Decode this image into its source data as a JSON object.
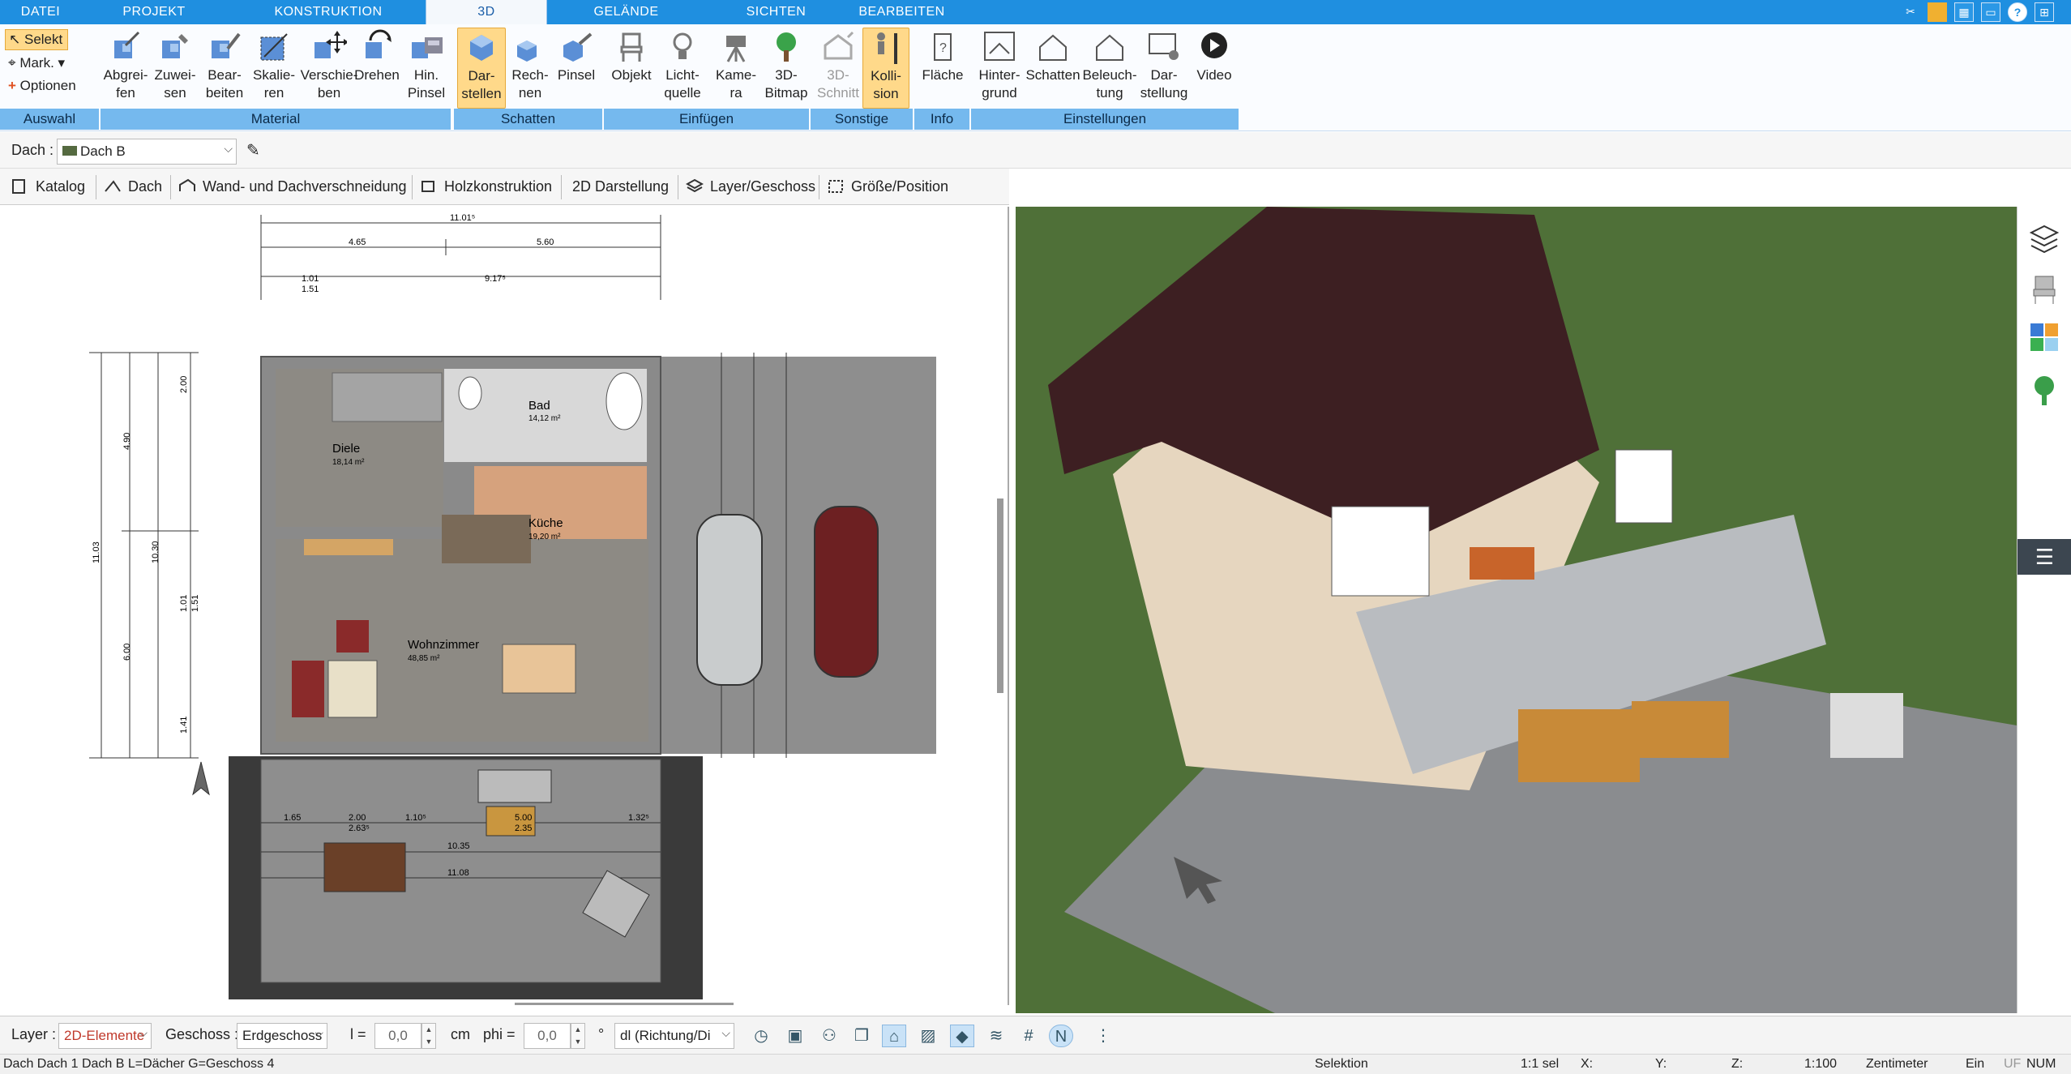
{
  "tabs": [
    "DATEI",
    "PROJEKT",
    "KONSTRUKTION",
    "3D",
    "GELÄNDE",
    "SICHTEN",
    "BEARBEITEN"
  ],
  "auswahl": {
    "select": "Selekt",
    "mark": "Mark.",
    "options": "Optionen",
    "group": "Auswahl"
  },
  "ribbon": {
    "material": [
      "Abgrei-\nfen",
      "Zuwei-\nsen",
      "Bear-\nbeiten",
      "Skalie-\nren",
      "Verschie-\nben",
      "Drehen",
      "Hin.\nPinsel"
    ],
    "schatten": [
      "Dar-\nstellen",
      "Rech-\nnen",
      "Pinsel"
    ],
    "einfuegen": [
      "Objekt",
      "Licht-\nquelle",
      "Kame-\nra",
      "3D-\nBitmap"
    ],
    "sonstige": [
      "3D-\nSchnitt",
      "Kolli-\nsion"
    ],
    "info": [
      "Fläche"
    ],
    "einstellungen": [
      "Hinter-\ngrund",
      "Schatten",
      "Beleuch-\ntung",
      "Dar-\nstellung",
      "Video"
    ]
  },
  "groups": [
    "Material",
    "Schatten",
    "Einfügen",
    "Sonstige",
    "Info",
    "Einstellungen"
  ],
  "roof": {
    "label": "Dach :",
    "value": "Dach B"
  },
  "toolbar": [
    "Katalog",
    "Dach",
    "Wand- und Dachverschneidung",
    "Holzkonstruktion",
    "2D Darstellung",
    "Layer/Geschoss",
    "Größe/Position"
  ],
  "plan": {
    "rooms": [
      {
        "name": "Diele",
        "area": "18,14 m²"
      },
      {
        "name": "Bad",
        "area": "14,12 m²"
      },
      {
        "name": "Küche",
        "area": "19,20 m²"
      },
      {
        "name": "Wohnzimmer",
        "area": "48,85 m²"
      }
    ],
    "dims_top": [
      "11.01⁵",
      "4.65",
      "5.60",
      "9.17⁵",
      "1.01",
      "1.51"
    ],
    "dims_left": [
      "4.90",
      "2.00",
      "11.03",
      "10.30",
      "6.00",
      "1.01",
      "1.51",
      "1.41"
    ],
    "dims_terrace": [
      "1.65",
      "2.00",
      "2.63⁵",
      "1.10⁵",
      "5.00",
      "2.35",
      "1.32⁵",
      "10.35",
      "11.08"
    ]
  },
  "bottom": {
    "layer_label": "Layer :",
    "layer_value": "2D-Elemente",
    "geschoss_label": "Geschoss :",
    "geschoss_value": "Erdgeschoss",
    "l_label": "l =",
    "l_value": "0,0",
    "l_unit": "cm",
    "phi_label": "phi =",
    "phi_value": "0,0",
    "phi_unit": "°",
    "dir_value": "dl (Richtung/Di"
  },
  "status": {
    "left": "Dach Dach 1 Dach B L=Dächer G=Geschoss 4",
    "mode": "Selektion",
    "sel": "1:1 sel",
    "x": "X:",
    "y": "Y:",
    "z": "Z:",
    "scale": "1:100",
    "unit": "Zentimeter",
    "ein": "Ein",
    "uf": "UF",
    "num": "NUM"
  },
  "colors": {
    "tab": "#1f8fe0",
    "group": "#75b9ee",
    "accent": "#e6a93a"
  }
}
